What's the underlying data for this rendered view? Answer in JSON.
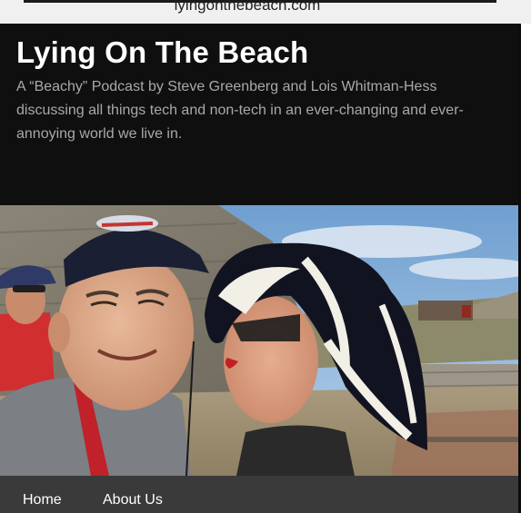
{
  "browser": {
    "url": "lyingonthebeach.com"
  },
  "header": {
    "title": "Lying On The Beach",
    "tagline": "A “Beachy” Podcast by Steve Greenberg and Lois Whitman-Hess discussing all things tech and non-tech in an ever-changing and ever-annoying world we live in."
  },
  "nav": {
    "items": [
      "Home",
      "About Us"
    ]
  },
  "colors": {
    "header_bg": "#0f0f0f",
    "nav_bg": "#3a3a3a",
    "tagline": "#a9a9a9",
    "title": "#ffffff"
  },
  "icons": []
}
